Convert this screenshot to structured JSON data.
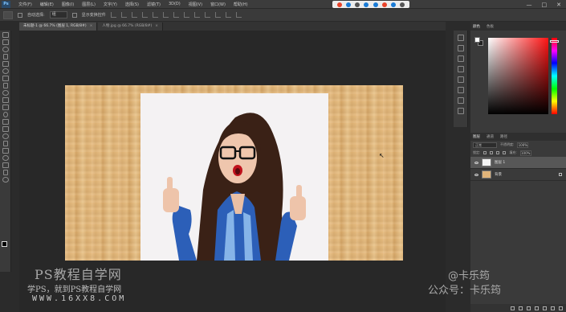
{
  "app": {
    "logo": "Ps"
  },
  "menu": {
    "items": [
      "文件(F)",
      "编辑(E)",
      "图像(I)",
      "图层(L)",
      "文字(Y)",
      "选择(S)",
      "滤镜(T)",
      "3D(D)",
      "视图(V)",
      "窗口(W)",
      "帮助(H)"
    ]
  },
  "window_controls": {
    "minimize": "—",
    "maximize": "□",
    "close": "✕"
  },
  "options_bar": {
    "auto_select_label": "自动选择:",
    "auto_select_value": "组",
    "show_transform_label": "显示变换控件"
  },
  "document_tabs": [
    {
      "label": "未标题-1 @ 66.7% (图层 1, RGB/8#)",
      "active": true
    },
    {
      "label": "人物.jpg @ 66.7% (RGB/8#)",
      "active": false
    }
  ],
  "panels": {
    "color_tabs": [
      "颜色",
      "色板"
    ],
    "layers_tabs": [
      "图层",
      "通道",
      "路径"
    ],
    "blend_mode": "正常",
    "opacity_label": "不透明度:",
    "opacity_value": "100%",
    "lock_label": "锁定:",
    "fill_label": "填充:",
    "fill_value": "100%",
    "layers": [
      {
        "name": "图层 1",
        "selected": true
      },
      {
        "name": "背景",
        "selected": false
      }
    ]
  },
  "watermark": {
    "title": "PS教程自学网",
    "line2": "学PS，就到PS教程自学网",
    "url": "WWW.16XX8.COM",
    "right_handle": "@卡乐筠",
    "right_account": "公众号：卡乐筠"
  },
  "colors": {
    "workspace": "#2b2b2b",
    "panel": "#3a3a3a",
    "wood": "#e0b47a",
    "selected_layer": "#575757"
  }
}
